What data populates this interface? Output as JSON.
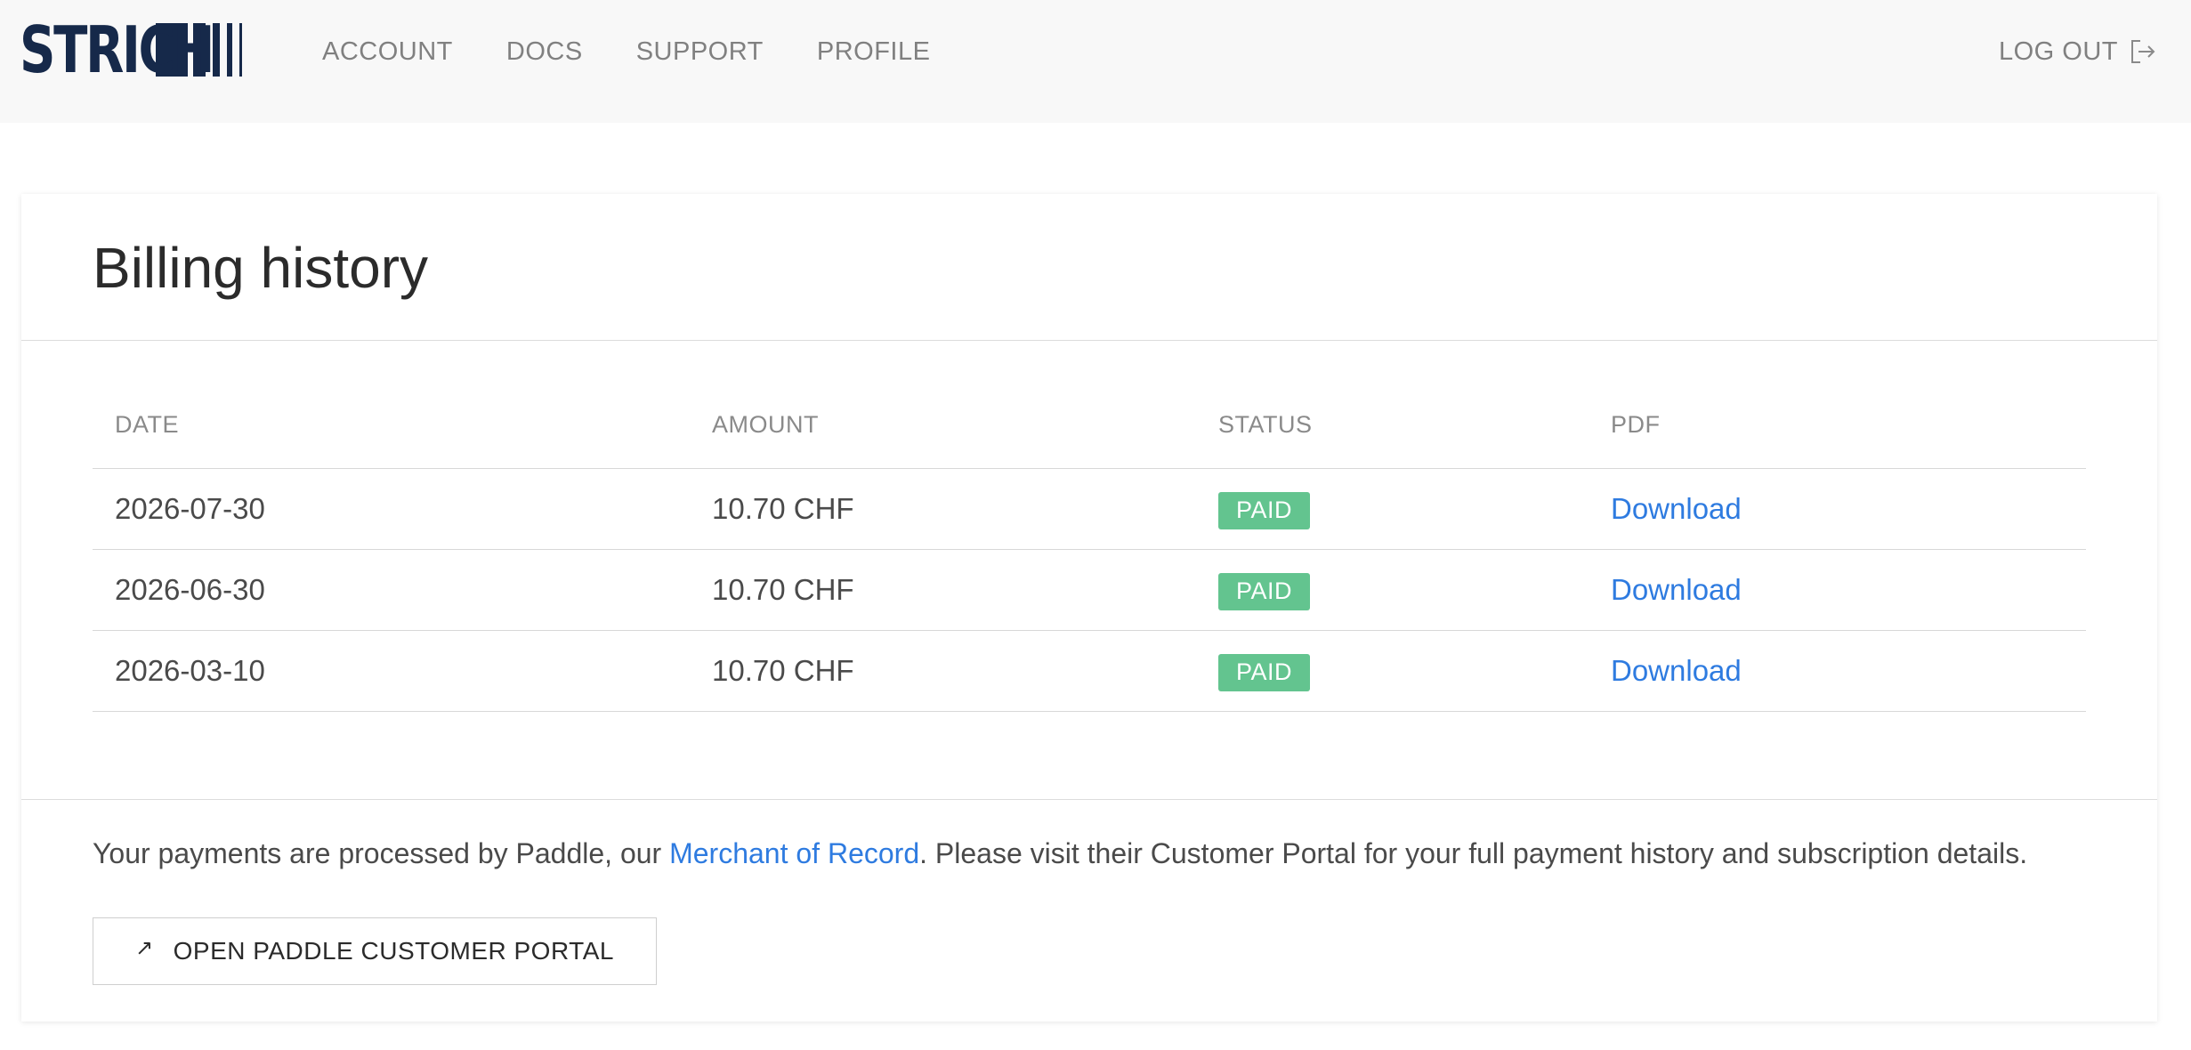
{
  "header": {
    "logo_text": "STRICH",
    "nav": [
      {
        "label": "ACCOUNT"
      },
      {
        "label": "DOCS"
      },
      {
        "label": "SUPPORT"
      },
      {
        "label": "PROFILE"
      }
    ],
    "logout_label": "LOG OUT",
    "logout_icon": "logout-icon"
  },
  "page": {
    "title": "Billing history"
  },
  "table": {
    "columns": [
      "DATE",
      "AMOUNT",
      "STATUS",
      "PDF"
    ],
    "rows": [
      {
        "date": "2026-07-30",
        "amount": "10.70 CHF",
        "status": "PAID",
        "pdf": "Download"
      },
      {
        "date": "2026-06-30",
        "amount": "10.70 CHF",
        "status": "PAID",
        "pdf": "Download"
      },
      {
        "date": "2026-03-10",
        "amount": "10.70 CHF",
        "status": "PAID",
        "pdf": "Download"
      }
    ]
  },
  "footer": {
    "text_before": "Your payments are processed by Paddle, our ",
    "link_text": "Merchant of Record",
    "text_after": ". Please visit their Customer Portal for your full payment history and subscription details.",
    "button_label": "OPEN PADDLE CUSTOMER PORTAL",
    "button_icon": "external-link-icon"
  },
  "colors": {
    "brand": "#16294a",
    "link": "#2e7be0",
    "paid_badge": "#63c48f",
    "topbar_bg": "#f8f8f8"
  }
}
